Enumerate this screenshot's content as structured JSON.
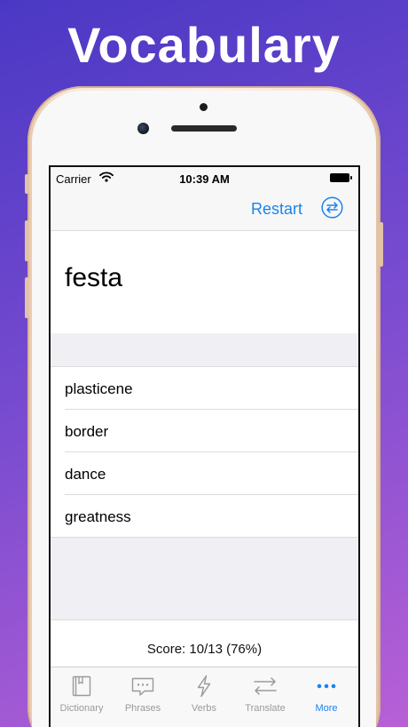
{
  "promo": {
    "title": "Vocabulary"
  },
  "status_bar": {
    "carrier": "Carrier",
    "time": "10:39 AM"
  },
  "nav": {
    "restart_label": "Restart",
    "swap_icon": "swap-arrows-icon"
  },
  "quiz": {
    "word": "festa",
    "choices": [
      {
        "label": "plasticene"
      },
      {
        "label": "border"
      },
      {
        "label": "dance"
      },
      {
        "label": "greatness"
      }
    ],
    "score": "Score: 10/13 (76%)"
  },
  "tab_bar": {
    "active": "More",
    "tabs": [
      {
        "label": "Dictionary",
        "icon": "book-icon"
      },
      {
        "label": "Phrases",
        "icon": "speech-bubble-icon"
      },
      {
        "label": "Verbs",
        "icon": "lightning-icon"
      },
      {
        "label": "Translate",
        "icon": "swap-arrows-icon"
      },
      {
        "label": "More",
        "icon": "ellipsis-icon"
      }
    ]
  },
  "colors": {
    "accent": "#1a82f0",
    "inactive": "#9a9a9a",
    "background_top": "#4a38c4",
    "background_bottom": "#b860d6",
    "grouped_bg": "#efeff4"
  }
}
